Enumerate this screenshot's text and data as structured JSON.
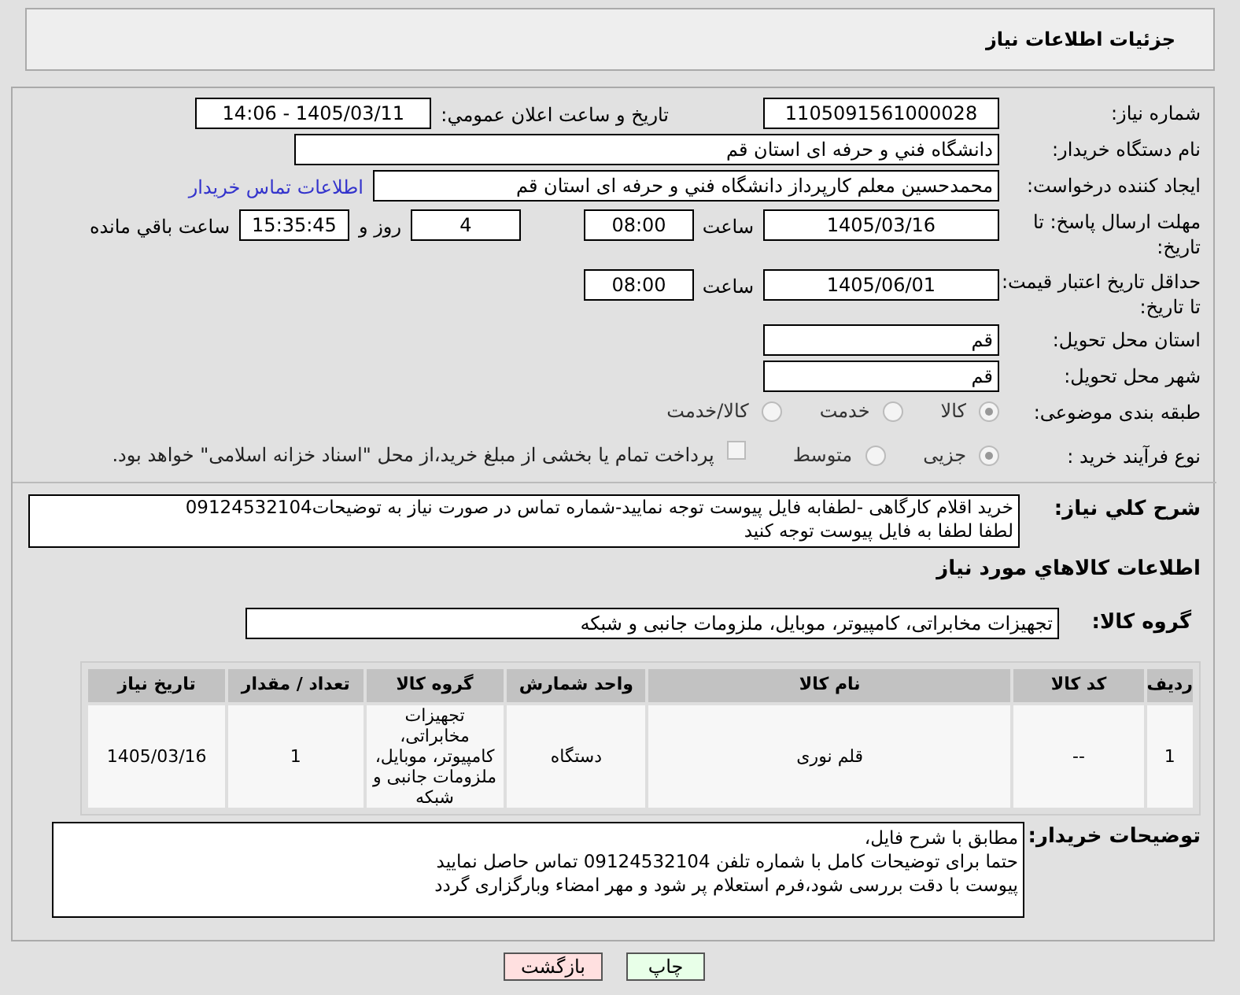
{
  "header": {
    "title": "جزئیات اطلاعات نیاز"
  },
  "need_number": {
    "label": "شماره نیاز:",
    "value": "1105091561000028"
  },
  "announce": {
    "label": "تاریخ و ساعت اعلان عمومي:",
    "value": "1405/03/11 - 14:06"
  },
  "buyer_org": {
    "label": "نام دستگاه خریدار:",
    "value": "دانشگاه فني و حرفه ای استان قم"
  },
  "requester": {
    "label": "ایجاد کننده درخواست:",
    "value": "محمدحسین معلم کارپرداز دانشگاه فني و حرفه ای استان قم",
    "link": "اطلاعات تماس خریدار"
  },
  "deadline": {
    "label": "مهلت ارسال پاسخ: تا تاریخ:",
    "date": "1405/03/16",
    "time_label": "ساعت",
    "time": "08:00",
    "days": "4",
    "days_label": "روز و",
    "remaining": "15:35:45",
    "remaining_label": "ساعت باقي مانده"
  },
  "validity": {
    "label": "حداقل تاریخ اعتبار قیمت: تا تاریخ:",
    "date": "1405/06/01",
    "time_label": "ساعت",
    "time": "08:00"
  },
  "province": {
    "label": "استان محل تحویل:",
    "value": "قم"
  },
  "city": {
    "label": "شهر محل تحویل:",
    "value": "قم"
  },
  "category": {
    "label": "طبقه بندی موضوعی:",
    "options": [
      {
        "label": "کالا",
        "selected": true
      },
      {
        "label": "خدمت",
        "selected": false
      },
      {
        "label": "کالا/خدمت",
        "selected": false
      }
    ]
  },
  "process": {
    "label": "نوع فرآیند خرید :",
    "options": [
      {
        "label": "جزیی",
        "selected": true
      },
      {
        "label": "متوسط",
        "selected": false
      }
    ],
    "checkbox": {
      "label": "پرداخت تمام یا بخشی از مبلغ خرید،از محل \"اسناد خزانه اسلامی\" خواهد بود.",
      "checked": false
    }
  },
  "description": {
    "label": "شرح کلي نیاز:",
    "lines": [
      "خرید اقلام کارگاهی -لطفابه فایل پیوست توجه نمایید-شماره تماس در صورت نیاز به توضیحات09124532104",
      "لطفا لطفا به فایل پیوست توجه کنید"
    ]
  },
  "goods_title": "اطلاعات کالاهاي مورد نیاز",
  "goods_group": {
    "label": "گروه کالا:",
    "value": "تجهیزات مخابراتی، کامپیوتر، موبایل، ملزومات جانبی و شبکه"
  },
  "table": {
    "columns": [
      "ردیف",
      "کد کالا",
      "نام کالا",
      "واحد شمارش",
      "گروه کالا",
      "تعداد / مقدار",
      "تاریخ نیاز"
    ],
    "rows": [
      [
        "1",
        "--",
        "قلم نوری",
        "دستگاه",
        "تجهیزات مخابراتی، کامپیوتر، موبایل، ملزومات جانبی و شبکه",
        "1",
        "1405/03/16"
      ]
    ]
  },
  "buyer_notes": {
    "label": "توضیحات خریدار:",
    "lines": [
      "مطابق با شرح فایل،",
      "حتما برای توضیحات کامل با شماره تلفن 09124532104 تماس حاصل نمایید",
      "پیوست با دقت بررسی شود،فرم استعلام پر شود و مهر امضاء وبارگزاری گردد"
    ]
  },
  "buttons": [
    {
      "label": "چاپ",
      "kind": "print"
    },
    {
      "label": "بازگشت",
      "kind": "back"
    }
  ]
}
